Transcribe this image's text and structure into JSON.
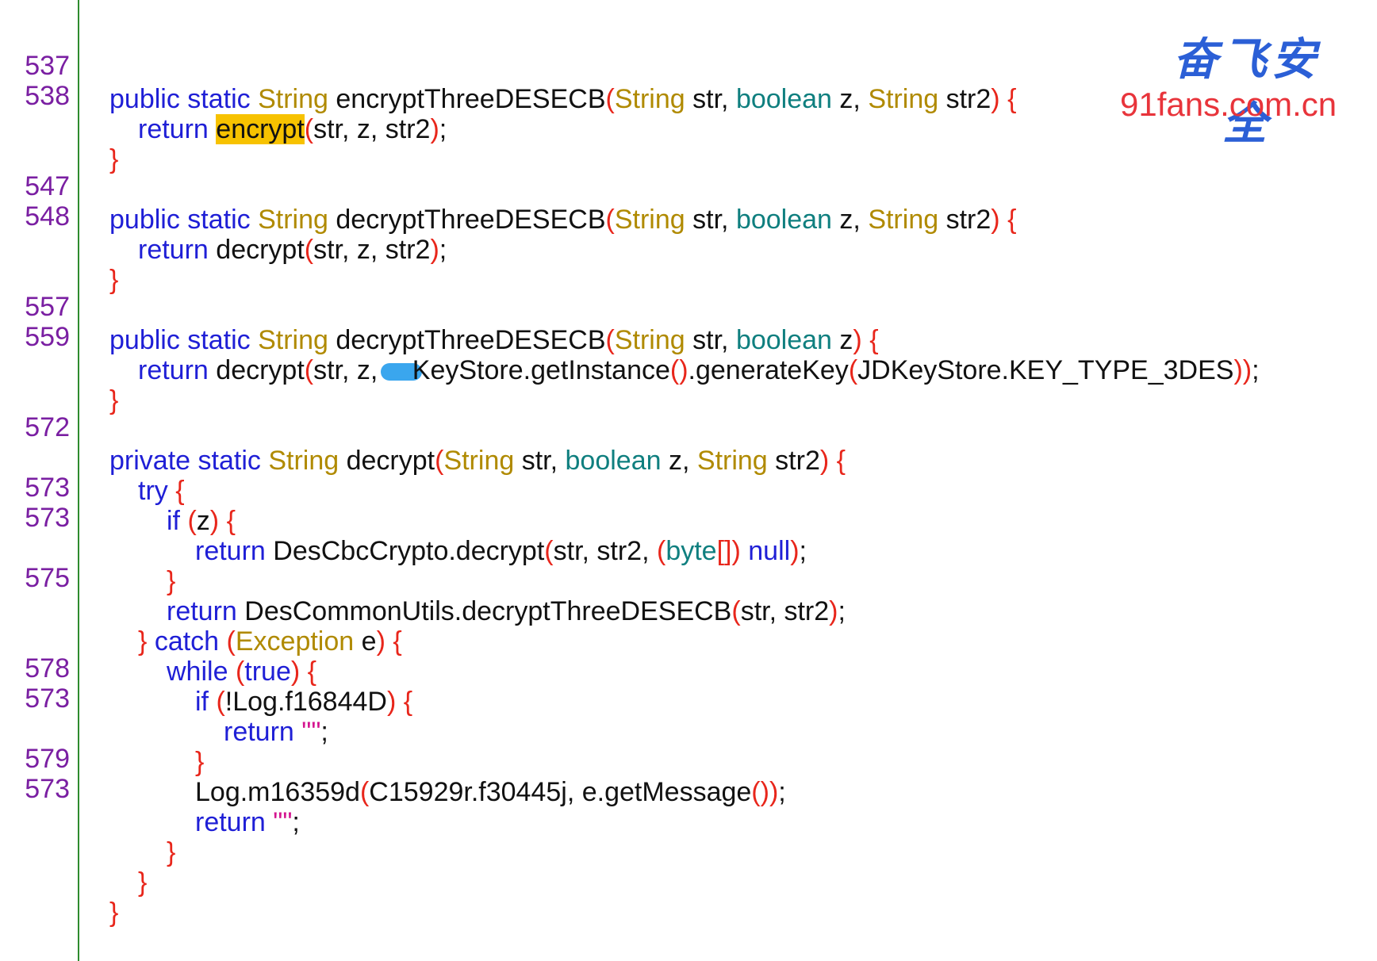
{
  "watermark": {
    "brand": "奋飞安全",
    "url": "91fans.com.cn"
  },
  "lines": [
    {
      "num": "537",
      "parts": [
        "public",
        "static",
        "String",
        "encryptThreeDESECB",
        "(",
        "String",
        "str, ",
        "boolean",
        "z, ",
        "String",
        "str2",
        ")",
        "{"
      ]
    },
    {
      "num": "538",
      "parts": [
        "return",
        "encrypt",
        "(",
        "str, z, str2",
        ")",
        ";"
      ]
    },
    {
      "num": "",
      "parts": [
        "}"
      ]
    },
    {
      "num": "547",
      "parts": [
        "public",
        "static",
        "String",
        "decryptThreeDESECB",
        "(",
        "String",
        "str, ",
        "boolean",
        "z, ",
        "String",
        "str2",
        ")",
        "{"
      ]
    },
    {
      "num": "548",
      "parts": [
        "return",
        "decrypt",
        "(",
        "str, z, str2",
        ")",
        ";"
      ]
    },
    {
      "num": "",
      "parts": [
        "}"
      ]
    },
    {
      "num": "557",
      "parts": [
        "public",
        "static",
        "String",
        "decryptThreeDESECB",
        "(",
        "String",
        "str, ",
        "boolean",
        "z",
        ")",
        "{"
      ]
    },
    {
      "num": "559",
      "parts": [
        "return",
        "decrypt",
        "(",
        "str, z, ",
        "KeyStore.getInstance",
        "()",
        ".generateKey",
        "(",
        "JDKeyStore.KEY_TYPE_3DES",
        "))",
        ";"
      ]
    },
    {
      "num": "",
      "parts": [
        "}"
      ]
    },
    {
      "num": "572",
      "parts": [
        "private",
        "static",
        "String",
        "decrypt",
        "(",
        "String",
        "str, ",
        "boolean",
        "z, ",
        "String",
        "str2",
        ")",
        "{"
      ]
    },
    {
      "num": "",
      "parts": [
        "try",
        "{"
      ]
    },
    {
      "num": "573",
      "parts": [
        "if",
        "(",
        "z",
        ")",
        "{"
      ]
    },
    {
      "num": "573",
      "parts": [
        "return",
        "DesCbcCrypto.decrypt",
        "(",
        "str, str2, ",
        "(",
        "byte",
        "[]",
        ")",
        "null",
        ")",
        ";"
      ]
    },
    {
      "num": "",
      "parts": [
        "}"
      ]
    },
    {
      "num": "575",
      "parts": [
        "return",
        "DesCommonUtils.decryptThreeDESECB",
        "(",
        "str, str2",
        ")",
        ";"
      ]
    },
    {
      "num": "",
      "parts": [
        "}",
        "catch",
        "(",
        "Exception",
        "e",
        ")",
        "{"
      ]
    },
    {
      "num": "",
      "parts": [
        "while",
        "(",
        "true",
        ")",
        "{"
      ]
    },
    {
      "num": "578",
      "parts": [
        "if",
        "(",
        "!Log.f16844D",
        ")",
        "{"
      ]
    },
    {
      "num": "573",
      "parts": [
        "return",
        "\"\"",
        ";"
      ]
    },
    {
      "num": "",
      "parts": [
        "}"
      ]
    },
    {
      "num": "579",
      "parts": [
        "Log.m16359d",
        "(",
        "C15929r.f30445j, e.getMessage",
        "())",
        ";"
      ]
    },
    {
      "num": "573",
      "parts": [
        "return",
        "\"\"",
        ";"
      ]
    },
    {
      "num": "",
      "parts": [
        "}"
      ]
    },
    {
      "num": "",
      "parts": [
        "}"
      ]
    },
    {
      "num": "",
      "parts": [
        "}"
      ]
    }
  ]
}
